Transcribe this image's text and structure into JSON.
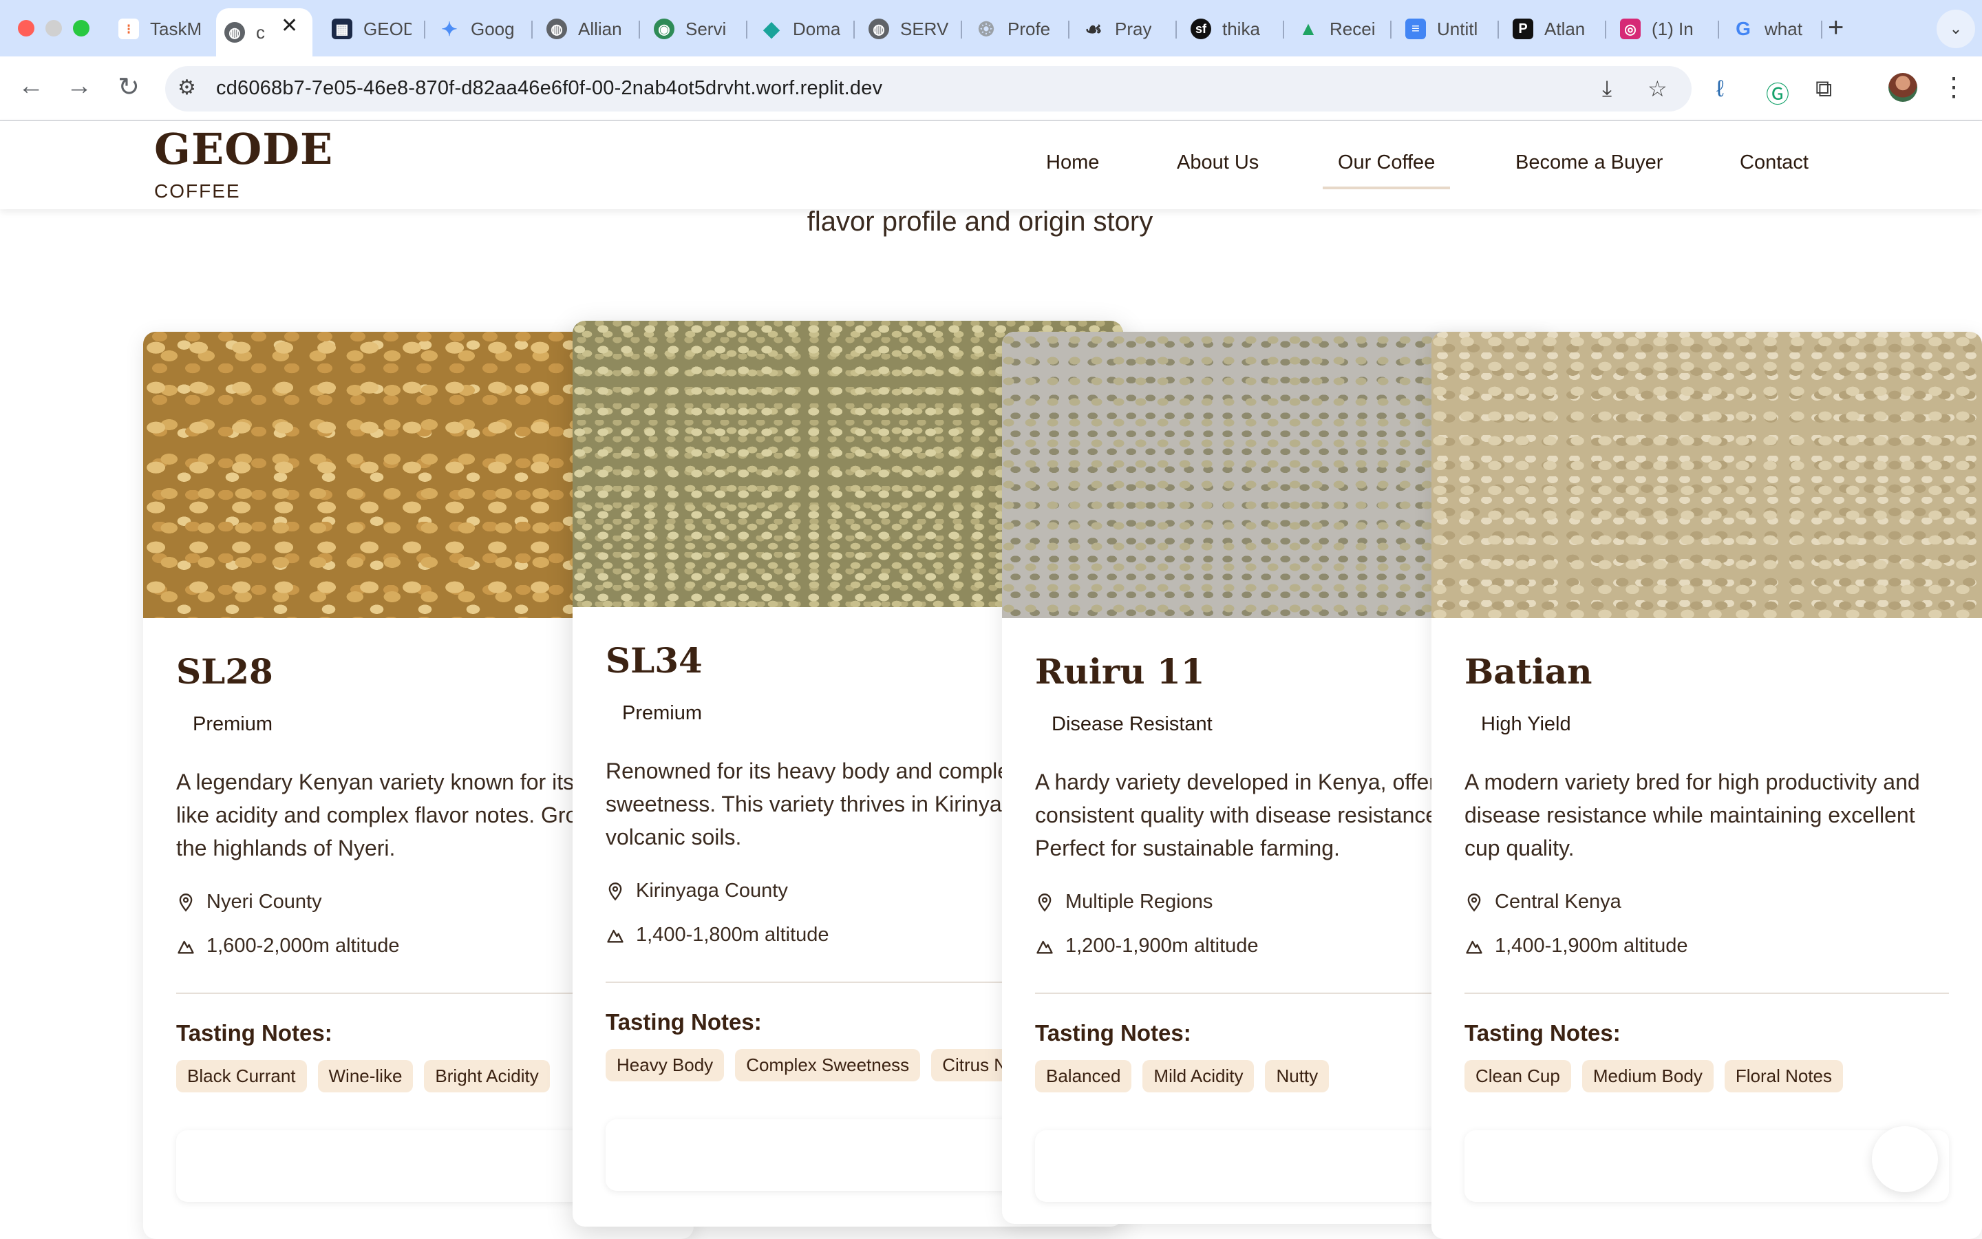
{
  "browser": {
    "tabs": [
      {
        "label": "TaskM",
        "icon": "taskmaster-icon",
        "color": "#f06a35"
      },
      {
        "label": "c",
        "icon": "globe-icon",
        "color": "#5f6368",
        "active": true
      },
      {
        "label": "GEOD",
        "icon": "geode-site-icon",
        "color": "#1c2a48"
      },
      {
        "label": "Goog",
        "icon": "gemini-icon",
        "color": "#4c8df6"
      },
      {
        "label": "Allian",
        "icon": "globe-icon",
        "color": "#5f6368"
      },
      {
        "label": "Servi",
        "icon": "service-icon",
        "color": "#2e8b57"
      },
      {
        "label": "Doma",
        "icon": "diamond-icon",
        "color": "#1aa39a"
      },
      {
        "label": "SERV",
        "icon": "globe-icon",
        "color": "#5f6368"
      },
      {
        "label": "Profe",
        "icon": "chatgpt-icon",
        "color": "#9aa0a6"
      },
      {
        "label": "Pray",
        "icon": "prayer-icon",
        "color": "#333333"
      },
      {
        "label": "thika",
        "icon": "symfony-icon",
        "color": "#111111"
      },
      {
        "label": "Recei",
        "icon": "drive-icon",
        "color": "#1fa463"
      },
      {
        "label": "Untitl",
        "icon": "docs-icon",
        "color": "#4285f4"
      },
      {
        "label": "Atlan",
        "icon": "pinterest-p-icon",
        "color": "#111111"
      },
      {
        "label": "(1) In",
        "icon": "instagram-icon",
        "color": "#d62976"
      },
      {
        "label": "what",
        "icon": "google-icon",
        "color": "#4285f4"
      }
    ],
    "url": "cd6068b7-7e05-46e8-870f-d82aa46e6f0f-00-2nab4ot5drvht.worf.replit.dev"
  },
  "site": {
    "brand": "GEODE",
    "brand_sub": "COFFEE",
    "nav": [
      {
        "label": "Home"
      },
      {
        "label": "About Us"
      },
      {
        "label": "Our Coffee",
        "active": true
      },
      {
        "label": "Become a Buyer"
      },
      {
        "label": "Contact"
      }
    ],
    "hero_subtitle": "flavor profile and origin story"
  },
  "coffees": [
    {
      "name": "SL28",
      "badge": "Premium",
      "description": "A legendary Kenyan variety known for its wine-like acidity and complex flavor notes. Grown in the highlands of Nyeri.",
      "location": "Nyeri County",
      "altitude": "1,600-2,000m altitude",
      "notes_title": "Tasting Notes:",
      "notes": [
        "Black Currant",
        "Wine-like",
        "Bright Acidity"
      ]
    },
    {
      "name": "SL34",
      "badge": "Premium",
      "description": "Renowned for its heavy body and complex sweetness. This variety thrives in Kirinyaga's volcanic soils.",
      "location": "Kirinyaga County",
      "altitude": "1,400-1,800m altitude",
      "notes_title": "Tasting Notes:",
      "notes": [
        "Heavy Body",
        "Complex Sweetness",
        "Citrus Notes"
      ]
    },
    {
      "name": "Ruiru 11",
      "badge": "Disease Resistant",
      "description": "A hardy variety developed in Kenya, offering consistent quality with disease resistance. Perfect for sustainable farming.",
      "location": "Multiple Regions",
      "altitude": "1,200-1,900m altitude",
      "notes_title": "Tasting Notes:",
      "notes": [
        "Balanced",
        "Mild Acidity",
        "Nutty"
      ]
    },
    {
      "name": "Batian",
      "badge": "High Yield",
      "description": "A modern variety bred for high productivity and disease resistance while maintaining excellent cup quality.",
      "location": "Central Kenya",
      "altitude": "1,400-1,900m altitude",
      "notes_title": "Tasting Notes:",
      "notes": [
        "Clean Cup",
        "Medium Body",
        "Floral Notes"
      ]
    }
  ],
  "colors": {
    "brand": "#3b2212",
    "chip_bg": "#f8ead9",
    "tabbar": "#d3e3fd"
  }
}
